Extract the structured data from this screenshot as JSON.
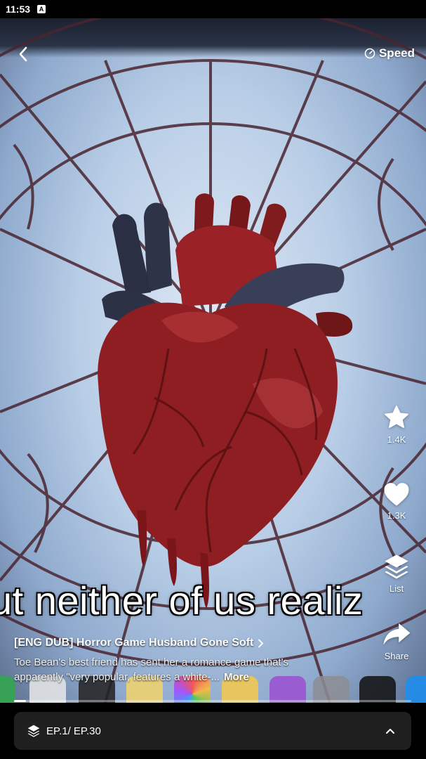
{
  "status_bar": {
    "time": "11:53",
    "notification_badge": "A"
  },
  "player": {
    "speed_label": "Speed",
    "subtitle": "ut neither of us realiz",
    "actions": [
      {
        "name": "favorite",
        "icon": "star-icon",
        "count": "1.4K"
      },
      {
        "name": "like",
        "icon": "heart-icon",
        "count": "1.3K"
      },
      {
        "name": "list",
        "icon": "layers-icon",
        "count": "List"
      },
      {
        "name": "share",
        "icon": "share-arrow-icon",
        "count": "Share"
      }
    ],
    "progress": 0.03
  },
  "show": {
    "title": "[ENG DUB] Horror Game Husband Gone Soft",
    "description": "Toe Bean's best friend has sent her a romance game that's apparently \"very popular, features a white-...",
    "more_label": "More"
  },
  "episode_bar": {
    "label": "EP.1/ EP.30"
  },
  "colors": {
    "accent_white": "#ffffff",
    "bar_bg": "#1f1f1f",
    "heart_red": "#8e1e22",
    "vein": "#5a1013"
  }
}
